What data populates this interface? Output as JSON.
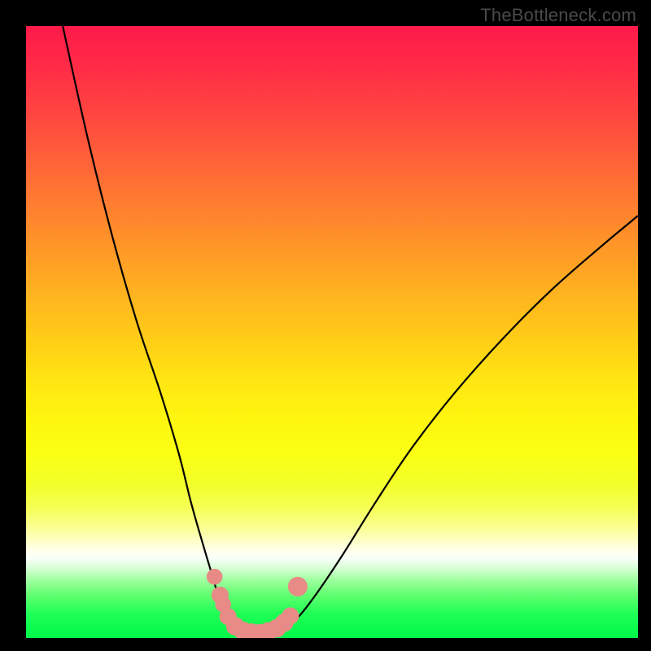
{
  "watermark": "TheBottleneck.com",
  "colors": {
    "frame": "#000000",
    "curve": "#000000",
    "marker": "#e88a86",
    "gradient_top": "#ff1a4a",
    "gradient_bottom": "#00f84a"
  },
  "chart_data": {
    "type": "line",
    "title": "",
    "xlabel": "",
    "ylabel": "",
    "xlim": [
      0,
      100
    ],
    "ylim": [
      0,
      100
    ],
    "grid": false,
    "legend": false,
    "note": "No axis ticks or numeric labels are shown; values are estimated from pixel positions on a 0-100 normalized scale (y=0 at bottom, y=100 at top).",
    "series": [
      {
        "name": "left-branch",
        "x": [
          6,
          10,
          14,
          18,
          22,
          25,
          27,
          29,
          30.5,
          31.5,
          32.5,
          33.5
        ],
        "y": [
          100,
          82,
          66,
          52,
          40,
          30,
          22,
          15,
          10,
          6.5,
          3.5,
          1.5
        ]
      },
      {
        "name": "valley",
        "x": [
          33.5,
          35,
          37,
          39,
          41,
          42.5
        ],
        "y": [
          1.5,
          0.6,
          0.3,
          0.3,
          0.6,
          1.5
        ]
      },
      {
        "name": "right-branch",
        "x": [
          42.5,
          45,
          48,
          52,
          57,
          63,
          70,
          78,
          86,
          94,
          100
        ],
        "y": [
          1.5,
          4,
          8,
          14,
          22,
          31,
          40,
          49,
          57,
          64,
          69
        ]
      }
    ],
    "markers": {
      "name": "valley-markers",
      "note": "Salient pink dots placed along the bottom of the V.",
      "points": [
        {
          "x": 30.8,
          "y": 10.0,
          "r": 1.3
        },
        {
          "x": 31.7,
          "y": 7.0,
          "r": 1.4
        },
        {
          "x": 32.2,
          "y": 5.5,
          "r": 1.3
        },
        {
          "x": 33.0,
          "y": 3.5,
          "r": 1.4
        },
        {
          "x": 34.2,
          "y": 1.9,
          "r": 1.5
        },
        {
          "x": 35.4,
          "y": 1.2,
          "r": 1.5
        },
        {
          "x": 36.8,
          "y": 0.9,
          "r": 1.5
        },
        {
          "x": 38.2,
          "y": 0.8,
          "r": 1.5
        },
        {
          "x": 39.6,
          "y": 1.1,
          "r": 1.5
        },
        {
          "x": 41.0,
          "y": 1.6,
          "r": 1.5
        },
        {
          "x": 42.2,
          "y": 2.5,
          "r": 1.5
        },
        {
          "x": 43.2,
          "y": 3.6,
          "r": 1.4
        },
        {
          "x": 44.4,
          "y": 8.4,
          "r": 1.6
        }
      ]
    }
  }
}
